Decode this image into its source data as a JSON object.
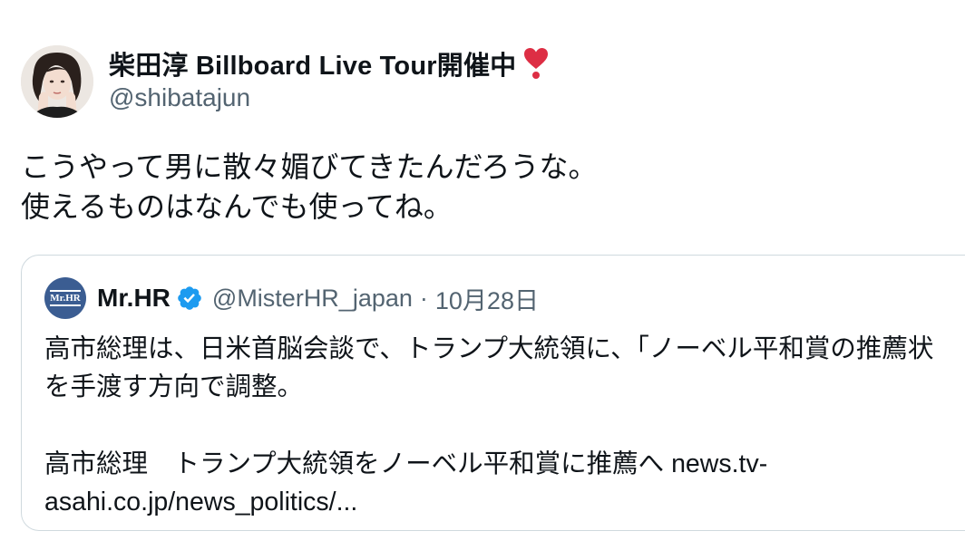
{
  "author": {
    "display_name": "柴田淳 Billboard Live Tour開催中",
    "emoji": "heavy-exclamation-heart",
    "handle": "@shibatajun"
  },
  "tweet": {
    "lines": [
      "こうやって男に散々媚びてきたんだろうな。",
      "使えるものはなんでも使ってね。"
    ]
  },
  "quote": {
    "avatar_text": "Mr.HR",
    "name": "Mr.HR",
    "handle": "@MisterHR_japan",
    "separator": "·",
    "date": "10月28日",
    "lines": [
      "高市総理は、日米首脳会談で、トランプ大統領に、「ノーベル平和賞の推薦状",
      "を手渡す方向で調整。"
    ],
    "link_prefix": "高市総理　トランプ大統領をノーベル平和賞に推薦へ ",
    "link_part1": "news.tv-",
    "link_part2": "asahi.co.jp/news_politics/..."
  },
  "colors": {
    "text": "#0f1419",
    "secondary": "#536471",
    "border": "#cfd9de",
    "verified": "#1d9bf0",
    "heart": "#dd2e44"
  }
}
